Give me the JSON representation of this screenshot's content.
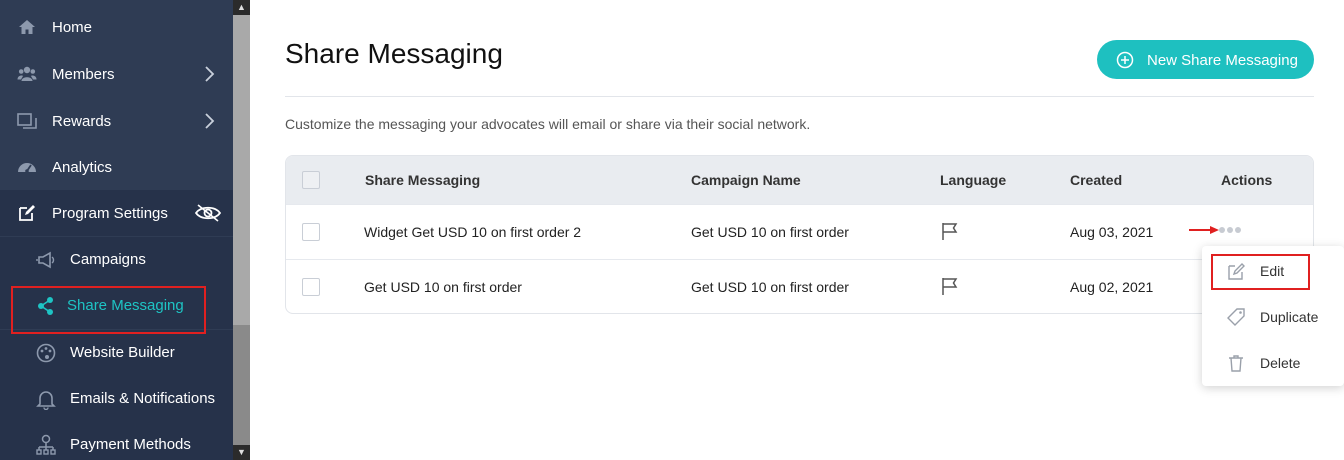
{
  "sidebar": {
    "items": [
      {
        "label": "Home",
        "icon": "home-icon"
      },
      {
        "label": "Members",
        "icon": "members-icon"
      },
      {
        "label": "Rewards",
        "icon": "rewards-icon"
      },
      {
        "label": "Analytics",
        "icon": "analytics-icon"
      },
      {
        "label": "Program Settings",
        "icon": "edit-icon"
      }
    ],
    "subitems": [
      {
        "label": "Campaigns",
        "icon": "megaphone-icon"
      },
      {
        "label": "Share Messaging",
        "icon": "share-icon"
      },
      {
        "label": "Website Builder",
        "icon": "palette-icon"
      },
      {
        "label": "Emails & Notifications",
        "icon": "bell-icon"
      },
      {
        "label": "Payment Methods",
        "icon": "payment-icon"
      }
    ]
  },
  "main": {
    "title": "Share Messaging",
    "new_button": "New Share Messaging",
    "subtitle": "Customize the messaging your advocates will email or share via their social network.",
    "table": {
      "headers": [
        "Share Messaging",
        "Campaign Name",
        "Language",
        "Created",
        "Actions"
      ],
      "rows": [
        {
          "name": "Widget Get USD 10 on first order 2",
          "campaign": "Get USD 10 on first order",
          "created": "Aug 03, 2021"
        },
        {
          "name": "Get USD 10 on first order",
          "campaign": "Get USD 10 on first order",
          "created": "Aug 02, 2021"
        }
      ]
    },
    "actions_menu": [
      "Edit",
      "Duplicate",
      "Delete"
    ]
  },
  "colors": {
    "sidebar_bg": "#2f3c54",
    "accent": "#1ec0c0",
    "highlight": "#e02020"
  }
}
